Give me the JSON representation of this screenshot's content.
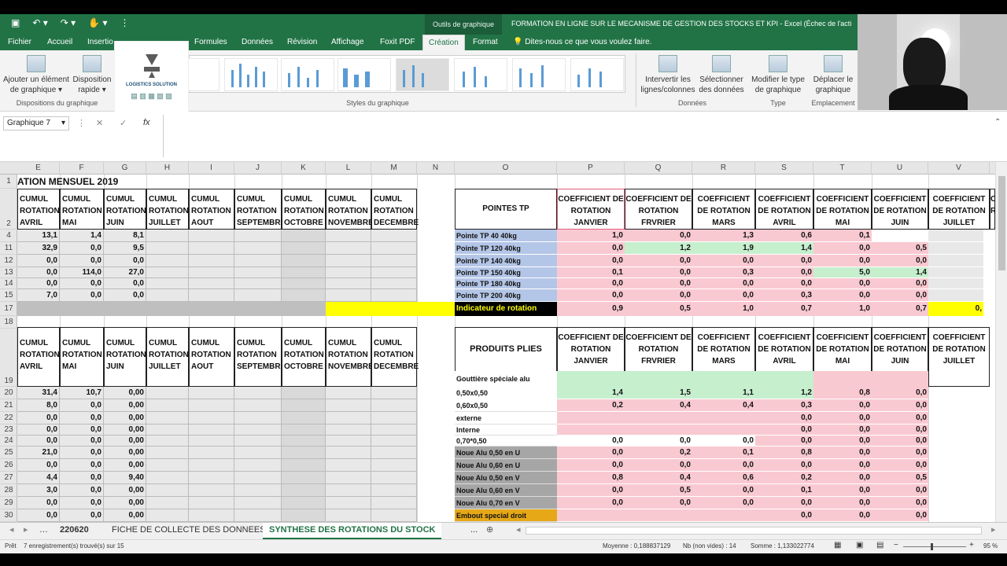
{
  "window": {
    "title": "FORMATION EN LIGNE SUR LE MECANISME DE GESTION DES STOCKS ET KPI - Excel (Échec de l'acti",
    "context_tools": "Outils de graphique"
  },
  "menu": [
    "Fichier",
    "Accueil",
    "Insertio",
    "Formules",
    "Données",
    "Révision",
    "Affichage",
    "Foxit PDF",
    "Création",
    "Format",
    "Dites-nous ce que vous voulez faire."
  ],
  "ribbon": {
    "add_element": "Ajouter un élément de graphique",
    "quick_layout": "Disposition rapide",
    "group_layouts": "Dispositions du graphique",
    "group_styles": "Styles du graphique",
    "switch_rowcol": "Intervertir les lignes/colonnes",
    "select_data": "Sélectionner des données",
    "group_data": "Données",
    "change_type": "Modifier le type de graphique",
    "group_type": "Type",
    "move_chart": "Déplacer le graphique",
    "group_location": "Emplacement",
    "logo_text": "LOGISTICS SOLUTION"
  },
  "formula_bar": {
    "name_box": "Graphique 7",
    "fx": "fx",
    "value": ""
  },
  "columns": [
    "E",
    "F",
    "G",
    "H",
    "I",
    "J",
    "K",
    "L",
    "M",
    "N",
    "O",
    "P",
    "Q",
    "R",
    "S",
    "T",
    "U",
    "V"
  ],
  "rows": [
    "1",
    "2",
    "4",
    "11",
    "12",
    "13",
    "14",
    "15",
    "17",
    "18",
    "19",
    "20",
    "21",
    "22",
    "23",
    "24",
    "25",
    "26",
    "27",
    "28",
    "29",
    "30"
  ],
  "sheet": {
    "title": "ATION MENSUEL 2019",
    "cumul_headers": [
      "CUMUL ROTATION AVRIL",
      "CUMUL ROTATION MAI",
      "CUMUL ROTATION JUIN",
      "CUMUL ROTATION JUILLET",
      "CUMUL ROTATION AOUT",
      "CUMUL ROTATION SEPTEMBRE",
      "CUMUL ROTATION OCTOBRE",
      "CUMUL ROTATION NOVEMBRE",
      "CUMUL ROTATION DECEMBRE"
    ],
    "top_cumul": [
      [
        "13,1",
        "1,4",
        "8,1"
      ],
      [
        "32,9",
        "0,0",
        "9,5"
      ],
      [
        "0,0",
        "0,0",
        "0,0"
      ],
      [
        "0,0",
        "114,0",
        "27,0"
      ],
      [
        "0,0",
        "0,0",
        "0,0"
      ],
      [
        "7,0",
        "0,0",
        "0,0"
      ]
    ],
    "pointes_header": "POINTES TP",
    "coef_headers": [
      "COEFFICIENT DE ROTATION JANVIER",
      "COEFFICIENT DE ROTATION FRVRIER",
      "COEFFICIENT DE ROTATION MARS",
      "COEFFICIENT DE ROTATION AVRIL",
      "COEFFICIENT DE ROTATION MAI",
      "COEFFICIENT DE ROTATION JUIN",
      "COEFFICIENT DE ROTATION JUILLET",
      "COE R"
    ],
    "pointes": [
      {
        "name": "Pointe TP 40 40kg",
        "vals": [
          "1,0",
          "0,0",
          "1,3",
          "0,6",
          "0,1",
          ""
        ]
      },
      {
        "name": "Pointe TP 120 40kg",
        "vals": [
          "0,0",
          "1,2",
          "1,9",
          "1,4",
          "0,0",
          "0,5"
        ]
      },
      {
        "name": "Pointe TP 140 40kg",
        "vals": [
          "0,0",
          "0,0",
          "0,0",
          "0,0",
          "0,0",
          "0,0"
        ]
      },
      {
        "name": "Pointe TP 150 40kg",
        "vals": [
          "0,1",
          "0,0",
          "0,3",
          "0,0",
          "5,0",
          "1,4"
        ]
      },
      {
        "name": "Pointe TP 180 40kg",
        "vals": [
          "0,0",
          "0,0",
          "0,0",
          "0,0",
          "0,0",
          "0,0"
        ]
      },
      {
        "name": "Pointe TP 200 40kg",
        "vals": [
          "0,0",
          "0,0",
          "0,0",
          "0,3",
          "0,0",
          "0,0"
        ]
      }
    ],
    "indicator_label": "Indicateur de rotation",
    "indicator_vals": [
      "0,9",
      "0,5",
      "1,0",
      "0,7",
      "1,0",
      "0,7",
      "0,"
    ],
    "bottom_cumul": [
      [
        "31,4",
        "10,7",
        "0,00"
      ],
      [
        "8,0",
        "0,0",
        "0,00"
      ],
      [
        "0,0",
        "0,0",
        "0,00"
      ],
      [
        "0,0",
        "0,0",
        "0,00"
      ],
      [
        "0,0",
        "0,0",
        "0,00"
      ],
      [
        "21,0",
        "0,0",
        "0,00"
      ],
      [
        "0,0",
        "0,0",
        "0,00"
      ],
      [
        "4,4",
        "0,0",
        "9,40"
      ],
      [
        "3,0",
        "0,0",
        "0,00"
      ],
      [
        "0,0",
        "0,0",
        "0,00"
      ],
      [
        "0,0",
        "0,0",
        "0,00"
      ]
    ],
    "produits_header": "PRODUITS PLIES",
    "produits": [
      {
        "name": "Gouttière spéciale alu",
        "name2": "0,50x0,50",
        "vals": [
          "1,4",
          "1,5",
          "1,1",
          "1,2",
          "0,8",
          "0,0"
        ]
      },
      {
        "name": "0,60x0,50",
        "vals": [
          "0,2",
          "0,4",
          "0,4",
          "0,3",
          "0,0",
          "0,0"
        ]
      },
      {
        "name": "externe",
        "vals": [
          "",
          "",
          "",
          "0,0",
          "0,0",
          "0,0"
        ]
      },
      {
        "name": "Interne",
        "vals": [
          "",
          "",
          "",
          "0,0",
          "0,0",
          "0,0"
        ]
      },
      {
        "name": "0,70*0,50",
        "vals": [
          "0,0",
          "0,0",
          "0,0",
          "0,0",
          "0,0",
          "0,0"
        ]
      },
      {
        "name": "Noue Alu 0,50 en U",
        "vals": [
          "0,0",
          "0,2",
          "0,1",
          "0,8",
          "0,0",
          "0,0"
        ]
      },
      {
        "name": "Noue Alu 0,60 en U",
        "vals": [
          "0,0",
          "0,0",
          "0,0",
          "0,0",
          "0,0",
          "0,0"
        ]
      },
      {
        "name": "Noue Alu 0,50 en  V",
        "vals": [
          "0,8",
          "0,4",
          "0,6",
          "0,2",
          "0,0",
          "0,5"
        ]
      },
      {
        "name": "Noue Alu 0,60 en V",
        "vals": [
          "0,0",
          "0,5",
          "0,0",
          "0,1",
          "0,0",
          "0,0"
        ]
      },
      {
        "name": "Noue Alu 0,70 en V",
        "vals": [
          "0,0",
          "0,0",
          "0,0",
          "0,0",
          "0,0",
          "0,0"
        ]
      },
      {
        "name": "Embout special droit",
        "vals": [
          "",
          "",
          "",
          "0,0",
          "0,0",
          "0,0"
        ]
      }
    ]
  },
  "tabs": [
    "220620",
    "FICHE DE COLLECTE DES DONNEES",
    "SYNTHESE DES ROTATIONS DU STOCK",
    "..."
  ],
  "status": {
    "ready": "Prêt",
    "found": "7 enregistrement(s) trouvé(s) sur 15",
    "average": "Moyenne : 0,188837129",
    "count": "Nb (non vides) : 14",
    "sum": "Somme : 1,133022774",
    "zoom": "95 %"
  },
  "colors": {
    "green": "#217346",
    "pink": "#f9c9d1",
    "lightgreen": "#c6efce",
    "blue": "#b4c6e7",
    "yellow": "#ffff00",
    "gray": "#d9d9d9",
    "orange": "#e6a817"
  }
}
